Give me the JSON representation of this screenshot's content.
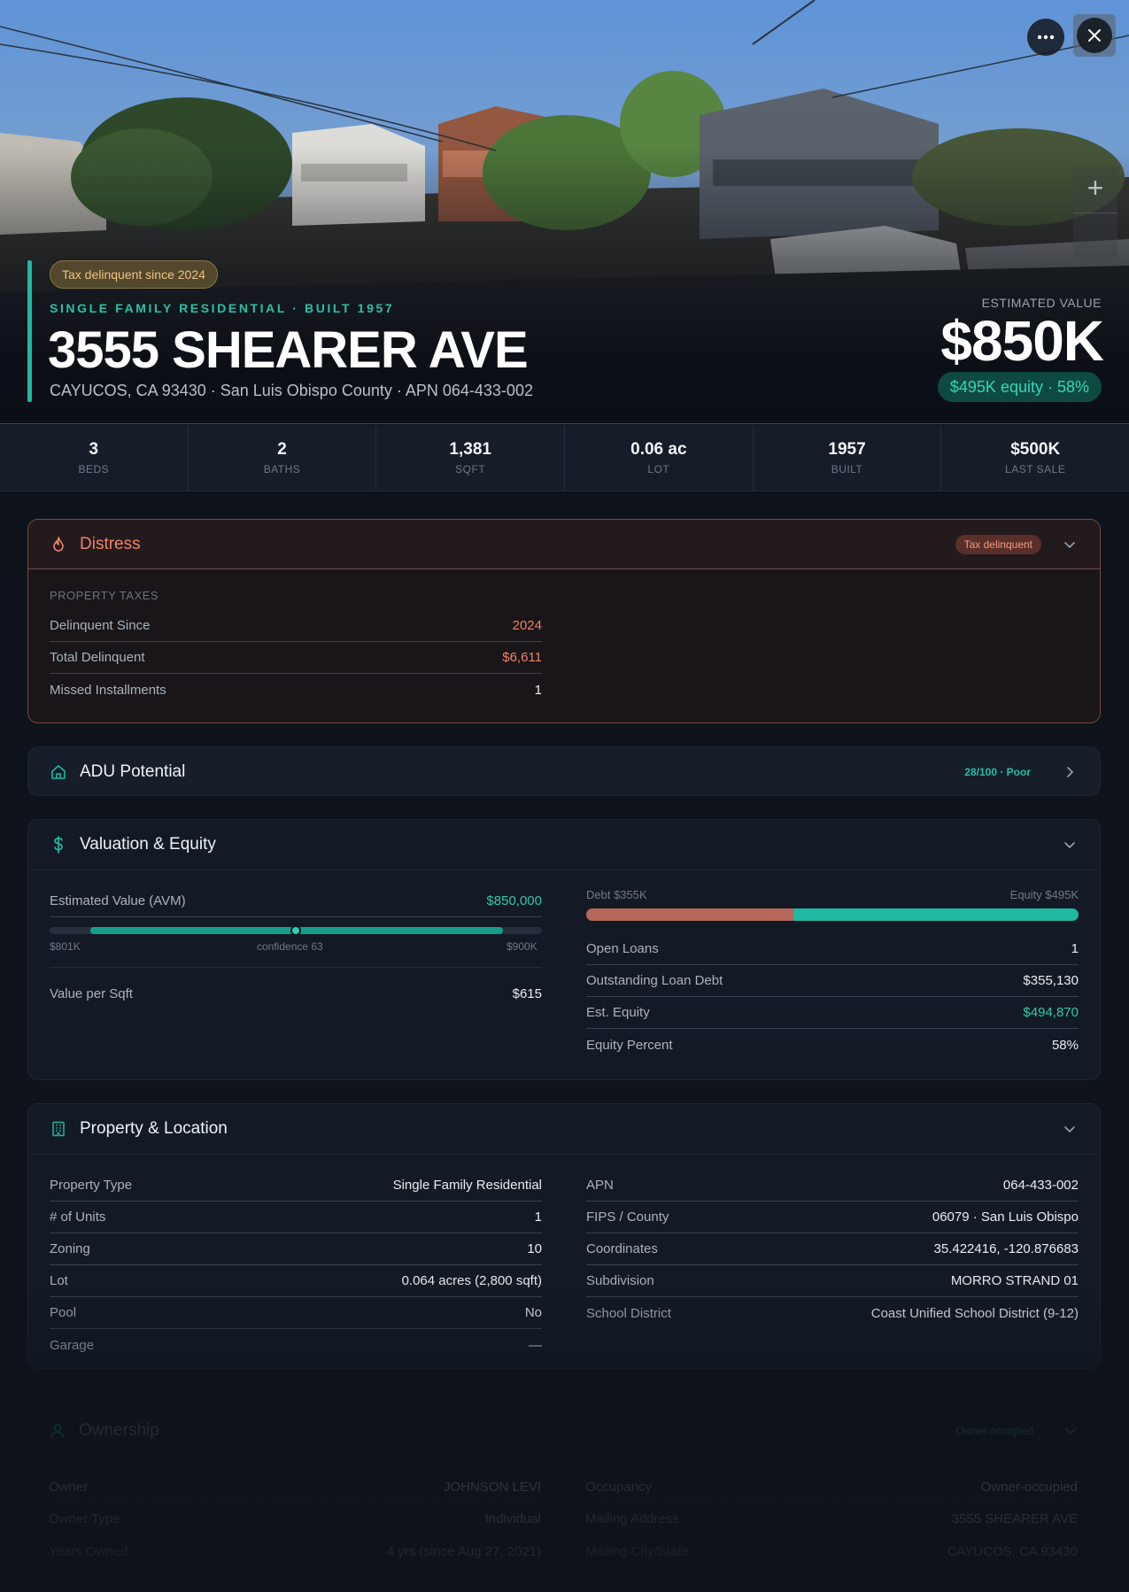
{
  "hero": {
    "tax_badge": "Tax delinquent since 2024",
    "subtitle": "SINGLE FAMILY RESIDENTIAL · BUILT 1957",
    "title": "3555 SHEARER AVE",
    "address_line": "CAYUCOS, CA 93430 · San Luis Obispo County · APN 064-433-002",
    "estimated_label": "ESTIMATED VALUE",
    "estimated_value": "$850K",
    "equity_badge": "$495K equity · 58%",
    "more_icon": "more-horizontal-icon",
    "close_icon": "close-icon",
    "zoom_icon": "plus-icon"
  },
  "stats": [
    {
      "value": "3",
      "label": "BEDS"
    },
    {
      "value": "2",
      "label": "BATHS"
    },
    {
      "value": "1,381",
      "label": "SQFT"
    },
    {
      "value": "0.06 ac",
      "label": "LOT"
    },
    {
      "value": "1957",
      "label": "BUILT"
    },
    {
      "value": "$500K",
      "label": "LAST SALE"
    }
  ],
  "distress": {
    "title": "Distress",
    "tag": "Tax delinquent",
    "section_label": "PROPERTY TAXES",
    "rows": [
      {
        "k": "Delinquent Since",
        "v": "2024"
      },
      {
        "k": "Total Delinquent",
        "v": "$6,611"
      },
      {
        "k": "Missed Installments",
        "v": "1"
      }
    ],
    "accent": "#ee8468"
  },
  "adu": {
    "title": "ADU Potential",
    "score": "28/100 · Poor",
    "score_value": 28
  },
  "valuation": {
    "title": "Valuation & Equity",
    "avm_label": "Estimated Value (AVM)",
    "avm_value": "$850,000",
    "range_low": "$801K",
    "range_high": "$900K",
    "confidence": "confidence 63",
    "value_per_sqft_label": "Value per Sqft",
    "value_per_sqft": "$615",
    "debt_label": "Debt $355K",
    "equity_label": "Equity $495K",
    "debt_fraction": 0.42,
    "rows": [
      {
        "k": "Open Loans",
        "v": "1"
      },
      {
        "k": "Outstanding Loan Debt",
        "v": "$355,130"
      },
      {
        "k": "Est. Equity",
        "v": "$494,870"
      },
      {
        "k": "Equity Percent",
        "v": "58%"
      }
    ],
    "colors": {
      "debt": "#b5675a",
      "equity": "#1fb8a0"
    }
  },
  "property": {
    "title": "Property & Location",
    "left": [
      {
        "k": "Property Type",
        "v": "Single Family Residential"
      },
      {
        "k": "# of Units",
        "v": "1"
      },
      {
        "k": "Zoning",
        "v": "10"
      },
      {
        "k": "Lot",
        "v": "0.064 acres (2,800 sqft)"
      },
      {
        "k": "Pool",
        "v": "No"
      },
      {
        "k": "Garage",
        "v": "—"
      }
    ],
    "right": [
      {
        "k": "APN",
        "v": "064-433-002"
      },
      {
        "k": "FIPS / County",
        "v": "06079 · San Luis Obispo"
      },
      {
        "k": "Coordinates",
        "v": "35.422416, -120.876683"
      },
      {
        "k": "Subdivision",
        "v": "MORRO STRAND 01"
      },
      {
        "k": "School District",
        "v": "Coast Unified School District (9-12)"
      }
    ]
  },
  "ownership": {
    "title": "Ownership",
    "tag": "Owner-occupied",
    "left": [
      {
        "k": "Owner",
        "v": "JOHNSON LEVI"
      },
      {
        "k": "Owner Type",
        "v": "Individual"
      },
      {
        "k": "Years Owned",
        "v": "4 yrs (since Aug 27, 2021)"
      }
    ],
    "right": [
      {
        "k": "Occupancy",
        "v": "Owner-occupied"
      },
      {
        "k": "Mailing Address",
        "v": "3555 SHEARER AVE"
      },
      {
        "k": "Mailing City/State",
        "v": "CAYUCOS, CA 93430"
      }
    ]
  },
  "theme": {
    "accent": "#1fb8a0",
    "background": "#0e131b"
  }
}
